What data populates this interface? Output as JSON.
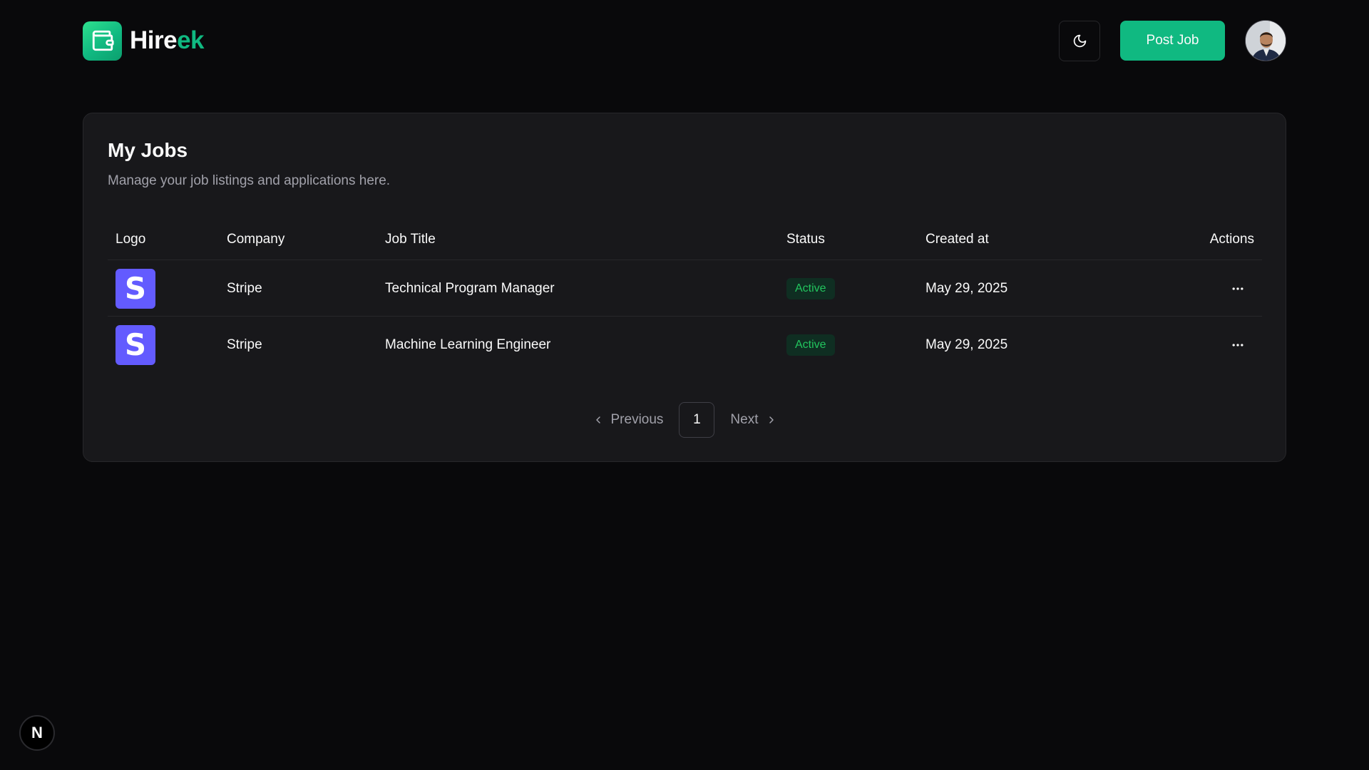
{
  "header": {
    "brand_part1": "Hire",
    "brand_part2": "ek",
    "post_job_label": "Post Job",
    "brand_color": "#10b981"
  },
  "main": {
    "title": "My Jobs",
    "description": "Manage your job listings and applications here.",
    "columns": [
      "Logo",
      "Company",
      "Job Title",
      "Status",
      "Created at",
      "Actions"
    ],
    "rows": [
      {
        "logo_letter": "S",
        "company": "Stripe",
        "job_title": "Technical Program Manager",
        "status": "Active",
        "created_at": "May 29, 2025"
      },
      {
        "logo_letter": "S",
        "company": "Stripe",
        "job_title": "Machine Learning Engineer",
        "status": "Active",
        "created_at": "May 29, 2025"
      }
    ]
  },
  "pagination": {
    "previous_label": "Previous",
    "current_page": "1",
    "next_label": "Next"
  },
  "next_badge": {
    "label": "N"
  },
  "colors": {
    "background": "#09090b",
    "card": "#18181b",
    "stripe_logo": "#635bff",
    "active_badge_text": "#22c55e"
  },
  "icons": {
    "brand": "wallet-icon",
    "theme_toggle": "moon-icon",
    "row_actions": "more-horizontal-icon",
    "previous": "chevron-left-icon",
    "next": "chevron-right-icon"
  }
}
